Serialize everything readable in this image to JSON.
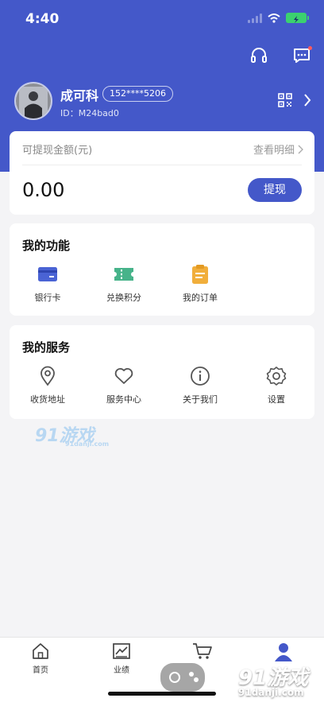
{
  "status": {
    "time": "4:40"
  },
  "colors": {
    "primary": "#4458c9",
    "func_bank": "#4a63d4",
    "func_points": "#47b38a",
    "func_orders": "#f1ae3b"
  },
  "profile": {
    "name": "成可科",
    "phone": "152****5206",
    "uid": "ID：M24bad0"
  },
  "withdraw": {
    "label": "可提现金额(元)",
    "detail_link": "查看明细",
    "amount": "0.00",
    "button": "提现"
  },
  "functions": {
    "title": "我的功能",
    "items": [
      {
        "label": "银行卡",
        "icon": "bank-card-icon"
      },
      {
        "label": "兑换积分",
        "icon": "ticket-icon"
      },
      {
        "label": "我的订单",
        "icon": "clipboard-icon"
      }
    ]
  },
  "services": {
    "title": "我的服务",
    "items": [
      {
        "label": "收货地址",
        "icon": "location-icon"
      },
      {
        "label": "服务中心",
        "icon": "heart-icon"
      },
      {
        "label": "关于我们",
        "icon": "info-icon"
      },
      {
        "label": "设置",
        "icon": "gear-icon"
      }
    ]
  },
  "tabs": [
    {
      "label": "首页",
      "icon": "home-icon"
    },
    {
      "label": "业绩",
      "icon": "chart-icon"
    },
    {
      "label": "",
      "icon": "cart-icon"
    },
    {
      "label": "",
      "icon": "user-icon"
    }
  ],
  "watermarks": {
    "center_main": "91游戏",
    "center_sub": "91danji.com",
    "corner_main": "91游戏",
    "corner_sub": "91danji.com"
  }
}
